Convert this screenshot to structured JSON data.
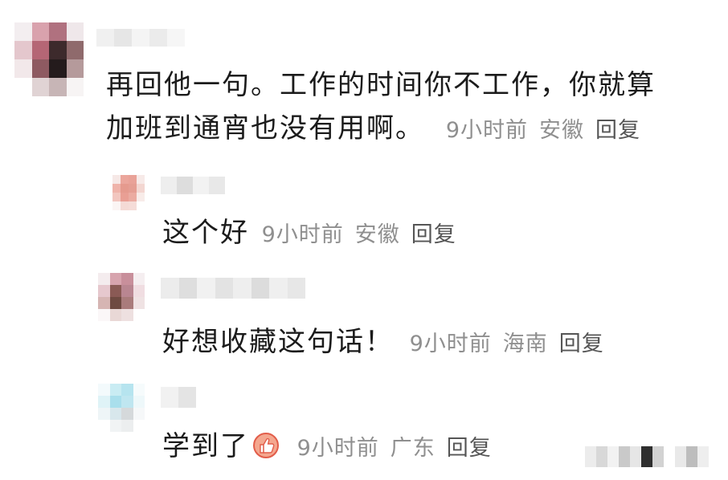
{
  "comments": [
    {
      "id": "main",
      "text_lines": [
        "再回他一句。工作的时间你不工作，你就算",
        "加班到通宵也没有用啊。"
      ],
      "time": "9小时前",
      "location": "安徽",
      "reply_label": "回复"
    },
    {
      "id": "reply1",
      "text_lines": [
        "这个好"
      ],
      "time": "9小时前",
      "location": "安徽",
      "reply_label": "回复"
    },
    {
      "id": "reply2",
      "text_lines": [
        "好想收藏这句话！"
      ],
      "time": "9小时前",
      "location": "海南",
      "reply_label": "回复"
    },
    {
      "id": "reply3",
      "text_lines": [
        "学到了"
      ],
      "emoji": "thumbs-up-icon",
      "time": "9小时前",
      "location": "广东",
      "reply_label": "回复"
    }
  ],
  "colors": {
    "meta_text": "#8f8f8f",
    "reply_text": "#555555",
    "body_text": "#1b1b1b"
  }
}
